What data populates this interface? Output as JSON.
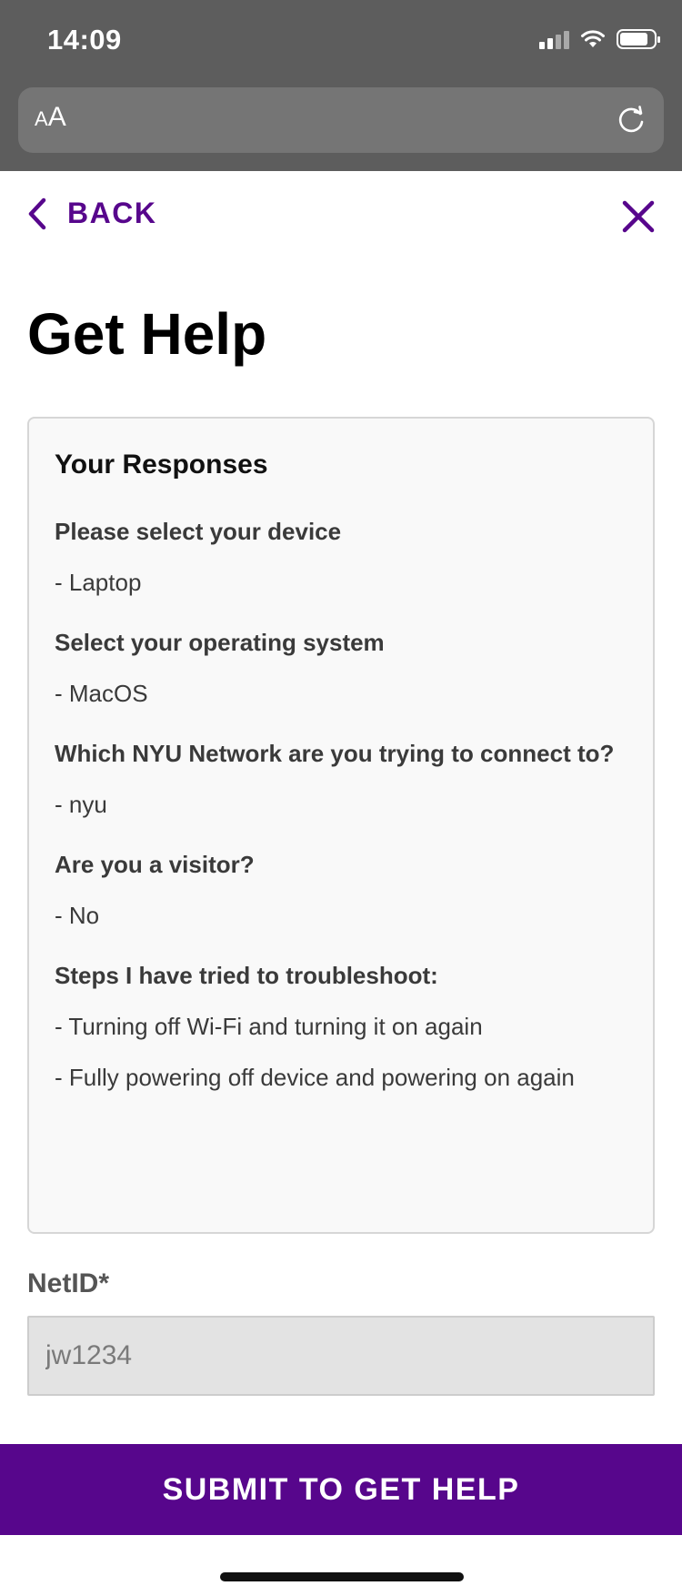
{
  "status_bar": {
    "time": "14:09"
  },
  "browser": {
    "text_size_label_small": "A",
    "text_size_label_large": "A"
  },
  "header": {
    "back_label": "BACK"
  },
  "page": {
    "title": "Get Help"
  },
  "responses": {
    "heading": "Your Responses",
    "items": [
      {
        "question": "Please select your device",
        "answers": [
          "- Laptop"
        ]
      },
      {
        "question": "Select your operating system",
        "answers": [
          "- MacOS"
        ]
      },
      {
        "question": "Which NYU Network are you trying to connect to?",
        "answers": [
          "- nyu"
        ]
      },
      {
        "question": "Are you a visitor?",
        "answers": [
          "- No"
        ]
      },
      {
        "question": "Steps I have tried to troubleshoot:",
        "answers": [
          "- Turning off Wi-Fi and turning it on again",
          "- Fully powering off device and powering on again"
        ]
      }
    ]
  },
  "netid": {
    "label": "NetID*",
    "placeholder": "jw1234",
    "value": ""
  },
  "submit": {
    "label": "SUBMIT TO GET HELP"
  },
  "colors": {
    "brand_purple": "#57068c",
    "chrome_gray": "#5d5d5d"
  }
}
